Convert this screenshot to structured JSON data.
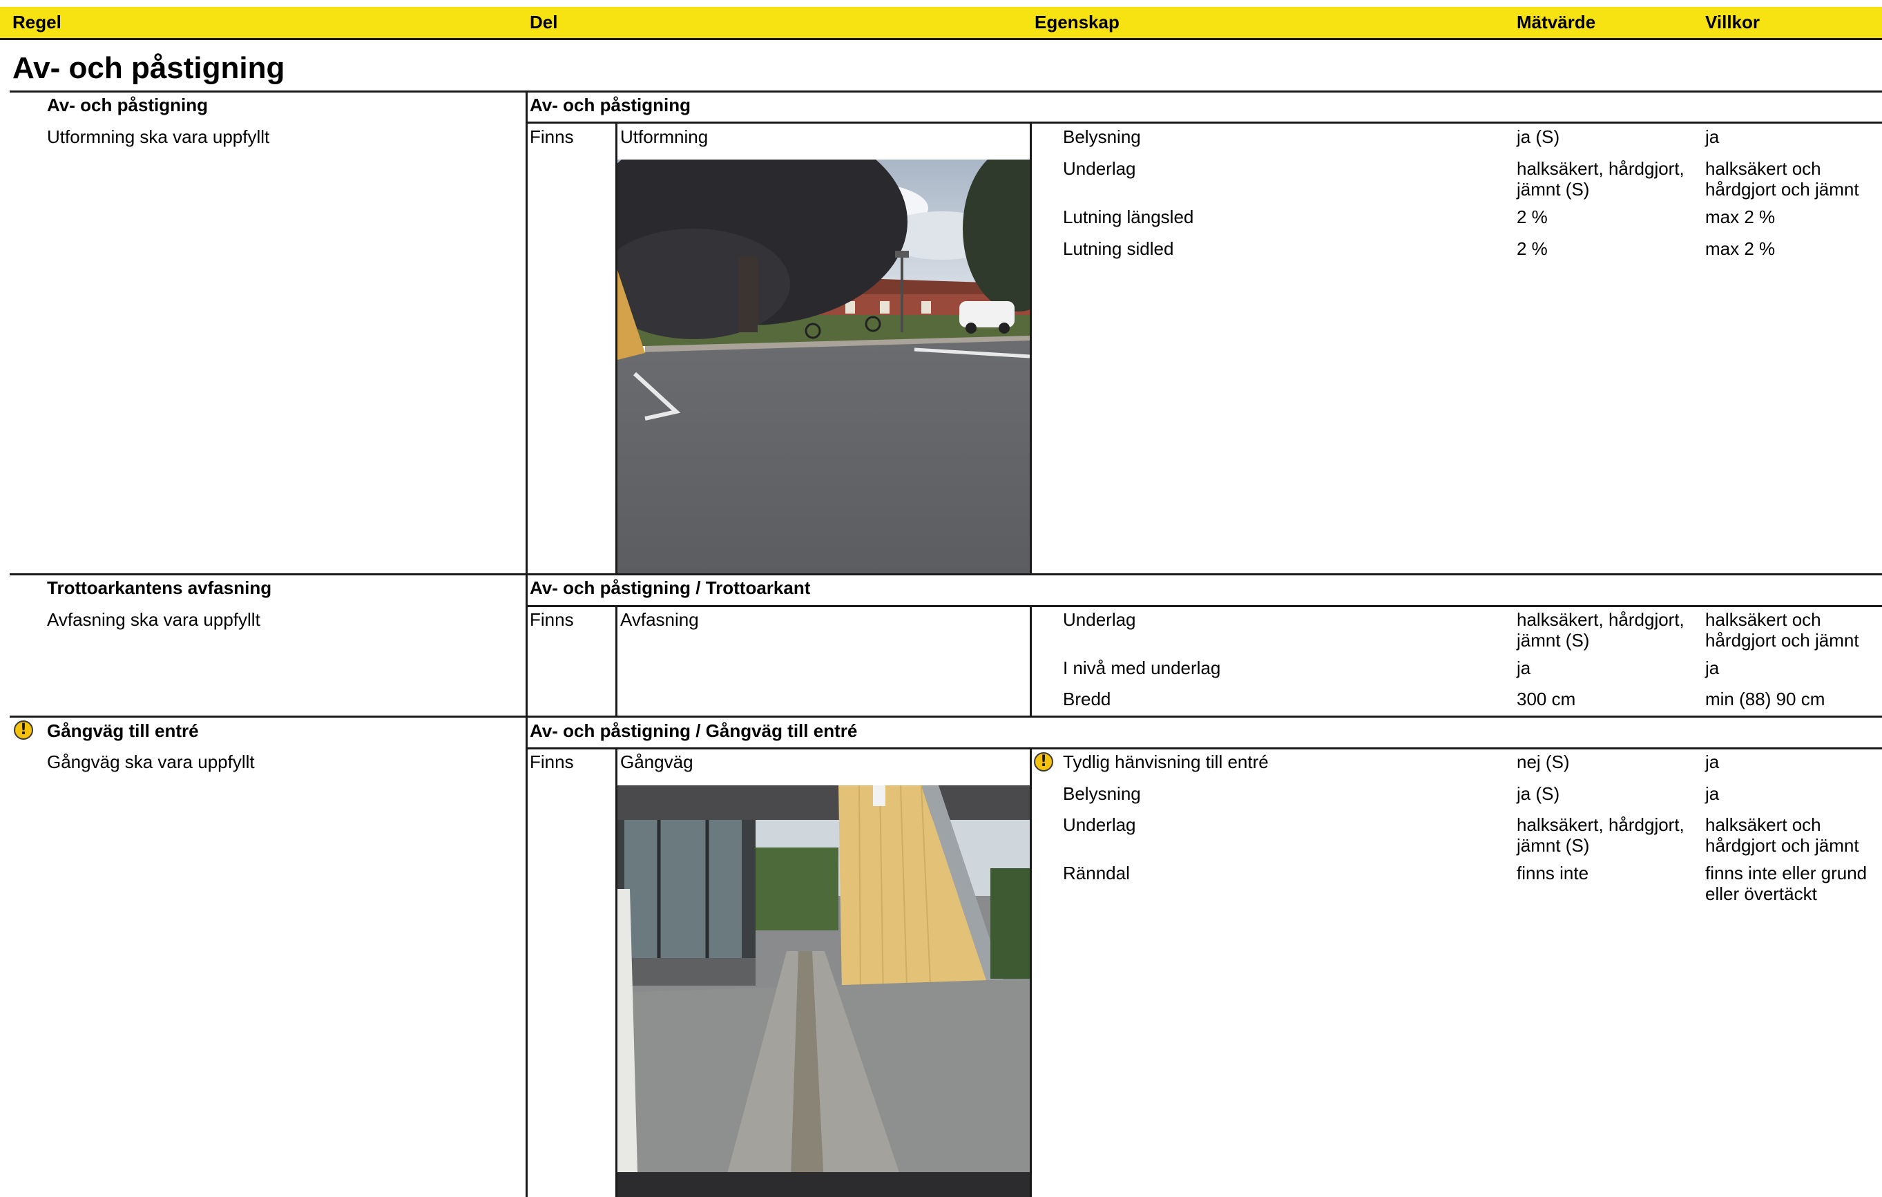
{
  "header": {
    "regel": "Regel",
    "del": "Del",
    "egenskap": "Egenskap",
    "matvarde": "Mätvärde",
    "villkor": "Villkor"
  },
  "section_title": "Av- och påstigning",
  "blocks": [
    {
      "rule_title": "Av- och påstigning",
      "rule_text": "Utformning ska vara uppfyllt",
      "part_path": "Av- och påstigning",
      "exists": "Finns",
      "part_name": "Utformning",
      "warning": false,
      "properties": [
        {
          "name": "Belysning",
          "value": "ja (S)",
          "condition": "ja",
          "warning": false
        },
        {
          "name": "Underlag",
          "value": "halksäkert, hårdgjort, jämnt (S)",
          "condition": "halksäkert och hårdgjort och jämnt",
          "warning": false
        },
        {
          "name": "Lutning längsled",
          "value": "2 %",
          "condition": "max 2 %",
          "warning": false
        },
        {
          "name": "Lutning sidled",
          "value": "2 %",
          "condition": "max 2 %",
          "warning": false
        }
      ]
    },
    {
      "rule_title": "Trottoarkantens avfasning",
      "rule_text": "Avfasning ska vara uppfyllt",
      "part_path": "Av- och påstigning / Trottoarkant",
      "exists": "Finns",
      "part_name": "Avfasning",
      "warning": false,
      "properties": [
        {
          "name": "Underlag",
          "value": "halksäkert, hårdgjort, jämnt (S)",
          "condition": "halksäkert och hårdgjort och jämnt",
          "warning": false
        },
        {
          "name": "I nivå med underlag",
          "value": "ja",
          "condition": "ja",
          "warning": false
        },
        {
          "name": "Bredd",
          "value": "300 cm",
          "condition": "min (88) 90 cm",
          "warning": false
        }
      ]
    },
    {
      "rule_title": "Gångväg till entré",
      "rule_text": "Gångväg ska vara uppfyllt",
      "part_path": "Av- och påstigning / Gångväg till entré",
      "exists": "Finns",
      "part_name": "Gångväg",
      "warning": true,
      "properties": [
        {
          "name": "Tydlig hänvisning till entré",
          "value": "nej (S)",
          "condition": "ja",
          "warning": true
        },
        {
          "name": "Belysning",
          "value": "ja (S)",
          "condition": "ja",
          "warning": false
        },
        {
          "name": "Underlag",
          "value": "halksäkert, hårdgjort, jämnt (S)",
          "condition": "halksäkert och hårdgjort och jämnt",
          "warning": false
        },
        {
          "name": "Ränndal",
          "value": "finns inte",
          "condition": "finns inte eller grund eller övertäckt",
          "warning": false
        }
      ]
    }
  ],
  "icons": {
    "warning": "exclamation-warning-icon",
    "warning_glyph": "!",
    "warning_color": "#f4c20d"
  },
  "colors": {
    "header_bg": "#f7e312",
    "rule_line": "#1a1a1a"
  }
}
